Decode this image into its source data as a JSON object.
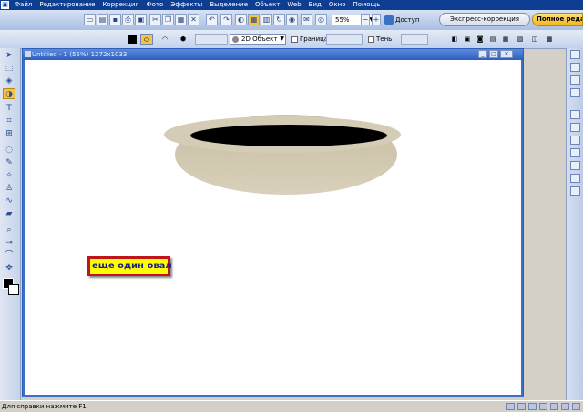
{
  "menubar": {
    "items": [
      "Файл",
      "Редактирование",
      "Коррекция",
      "Фото",
      "Эффекты",
      "Выделение",
      "Объект",
      "Web",
      "Вид",
      "Окно",
      "Помощь"
    ]
  },
  "toolbar": {
    "zoom_value": "55%",
    "access_label": "Доступ",
    "quick_fix_tab": "Экспресс-коррекция",
    "full_edit_tab": "Полное редактиров..."
  },
  "options": {
    "mode_select": "2D Объект",
    "border_label": "Граница",
    "shadow_label": "Тень"
  },
  "document": {
    "title": "Untitled - 1 (55%) 1272x1033"
  },
  "canvas": {
    "callout_text": "еще один овал"
  },
  "status": {
    "text": "Для справки нажмите F1"
  },
  "colors": {
    "menubar": "#0e3e92",
    "doc_frame": "#3b6fc9",
    "callout_fill": "#ffff00",
    "callout_border": "#c0131a",
    "callout_text": "#1b1b8c",
    "pot_texture": "#d9cfb4",
    "pot_opening": "#000000",
    "active_tab": "#f3b41c"
  }
}
